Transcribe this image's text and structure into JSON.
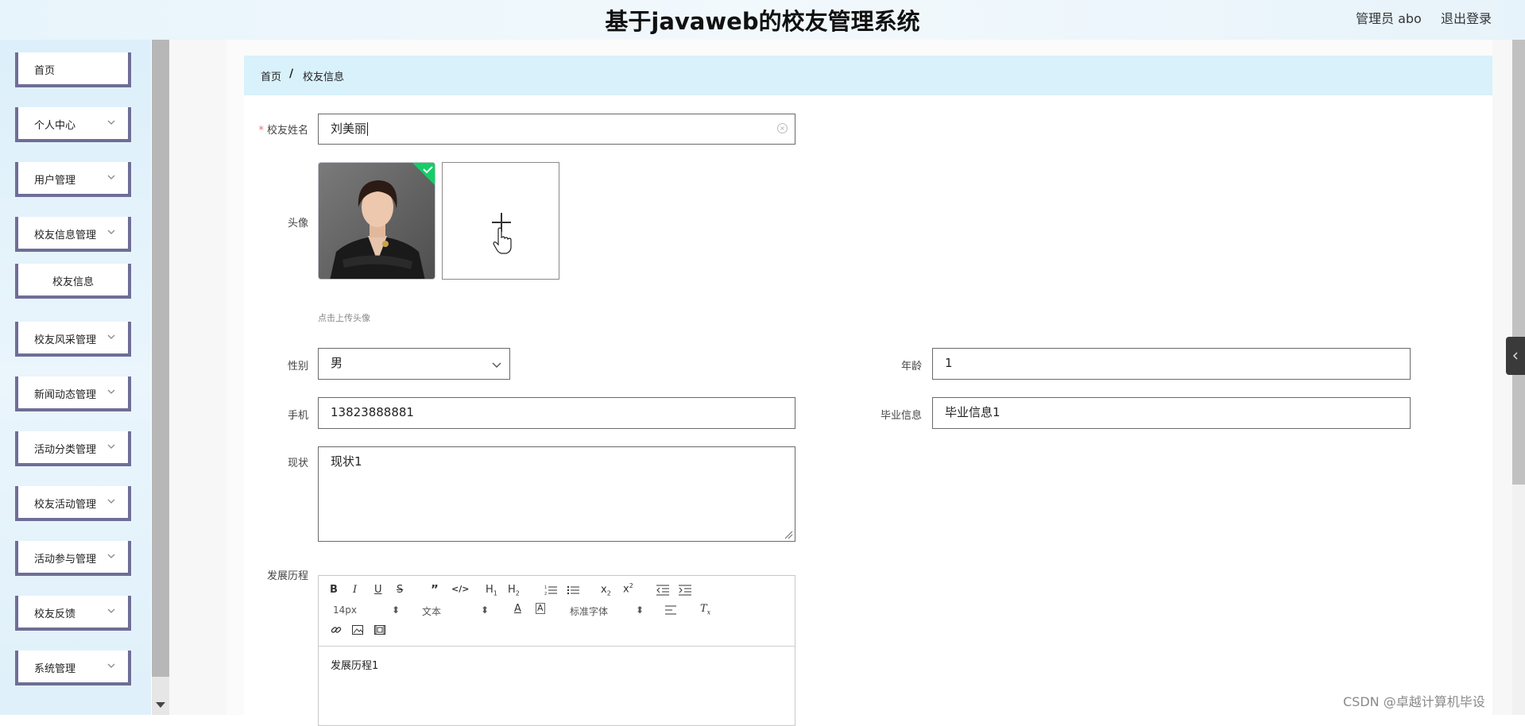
{
  "header": {
    "title": "基于javaweb的校友管理系统",
    "user": "管理员 abo",
    "logout": "退出登录"
  },
  "sidebar": {
    "items": [
      {
        "label": "首页",
        "has_arrow": false
      },
      {
        "label": "个人中心",
        "has_arrow": true
      },
      {
        "label": "用户管理",
        "has_arrow": true
      },
      {
        "label": "校友信息管理",
        "has_arrow": true
      },
      {
        "label": "校友信息",
        "has_arrow": false,
        "submenu": true
      },
      {
        "label": "校友风采管理",
        "has_arrow": true
      },
      {
        "label": "新闻动态管理",
        "has_arrow": true
      },
      {
        "label": "活动分类管理",
        "has_arrow": true
      },
      {
        "label": "校友活动管理",
        "has_arrow": true
      },
      {
        "label": "活动参与管理",
        "has_arrow": true
      },
      {
        "label": "校友反馈",
        "has_arrow": true
      },
      {
        "label": "系统管理",
        "has_arrow": true
      }
    ]
  },
  "breadcrumb": {
    "home": "首页",
    "separator": "/",
    "current": "校友信息"
  },
  "form": {
    "name": {
      "label": "校友姓名",
      "value": "刘美丽",
      "required": true
    },
    "avatar": {
      "label": "头像",
      "tip": "点击上传头像"
    },
    "gender": {
      "label": "性别",
      "value": "男"
    },
    "age": {
      "label": "年龄",
      "value": "1"
    },
    "phone": {
      "label": "手机",
      "value": "13823888881"
    },
    "graduation": {
      "label": "毕业信息",
      "value": "毕业信息1"
    },
    "status": {
      "label": "现状",
      "value": "现状1"
    },
    "history": {
      "label": "发展历程",
      "content": "发展历程1",
      "toolbar": {
        "size": "14px",
        "block": "文本",
        "font": "标准字体"
      }
    }
  },
  "watermark": "CSDN @卓越计算机毕设",
  "colors": {
    "menu_border": "#6e6e96",
    "breadcrumb_bg": "#d8f1fb",
    "header_bg": "#e8f4fb",
    "upload_success": "#13ce66"
  }
}
